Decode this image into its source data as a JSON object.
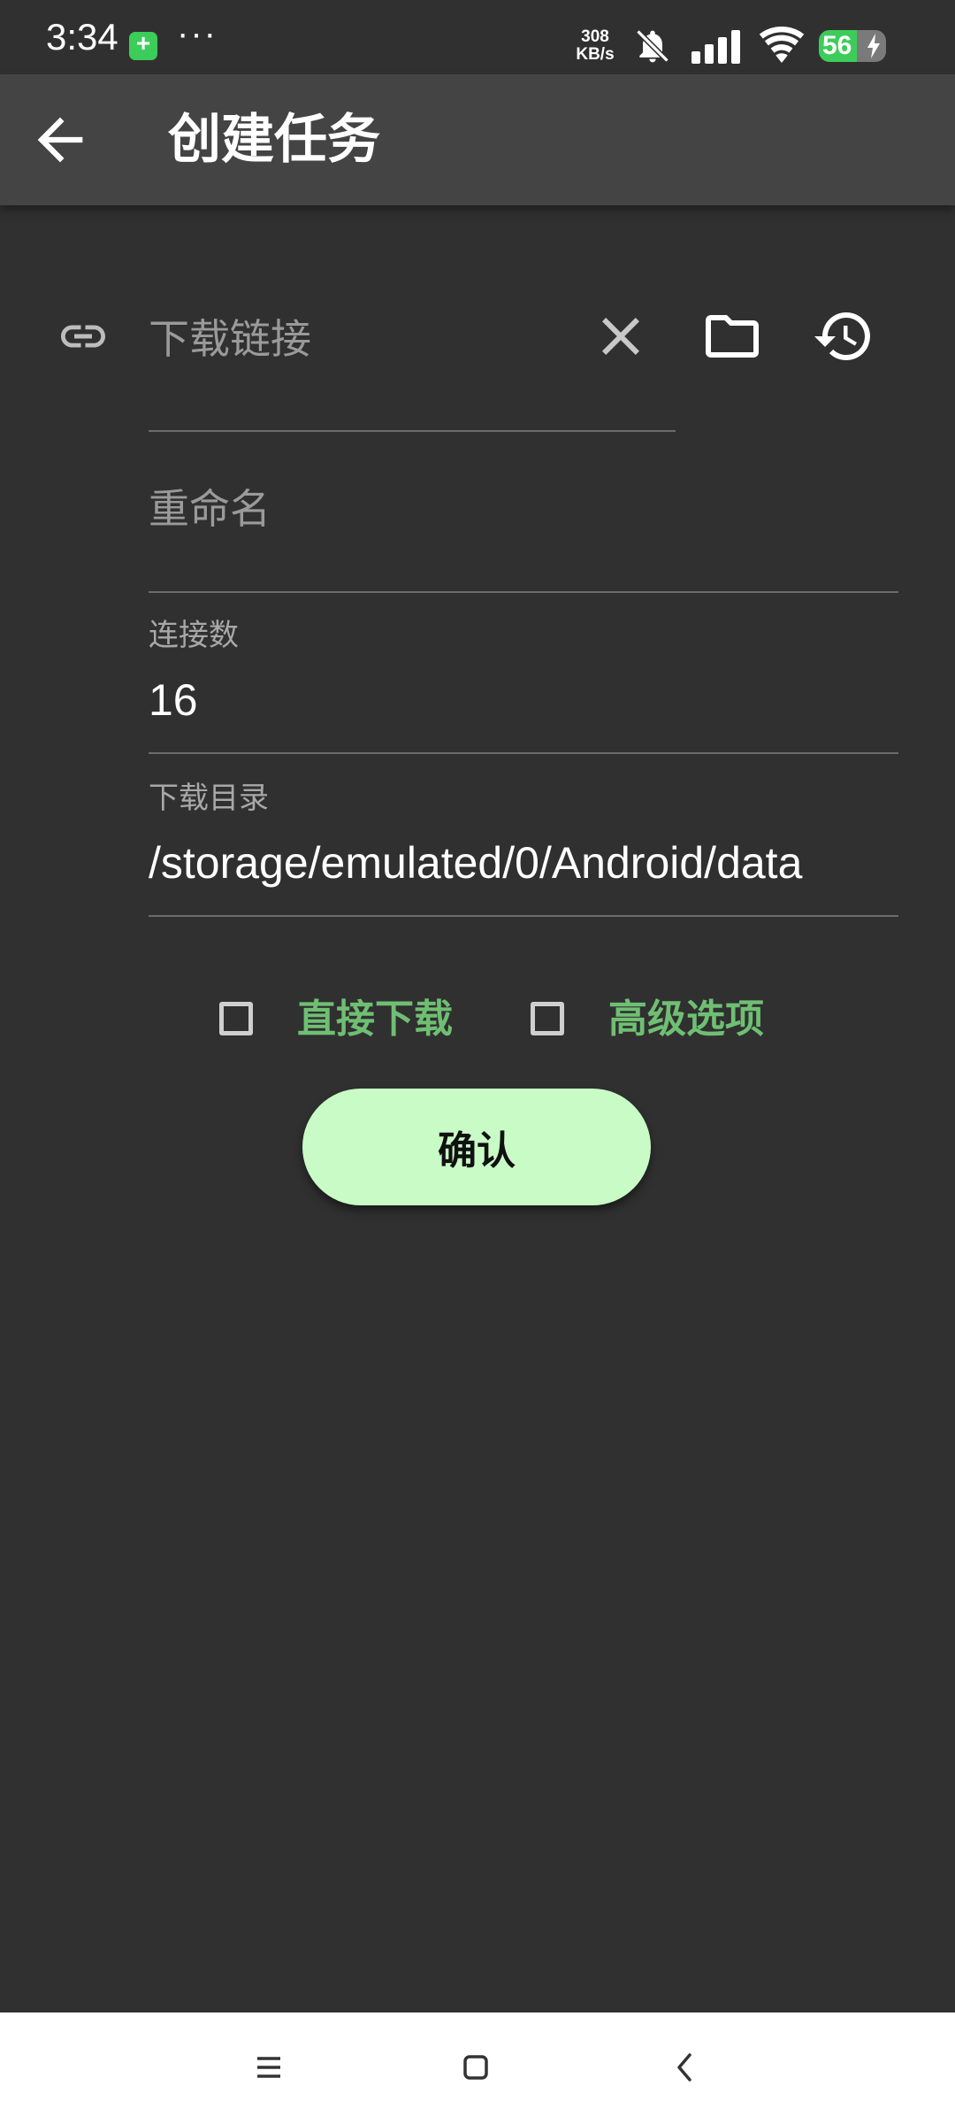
{
  "status_bar": {
    "time": "3:34",
    "overflow": "···",
    "net_speed_value": "308",
    "net_speed_unit": "KB/s",
    "battery_level": "56",
    "battery_fraction": 0.56,
    "icons": [
      "shield-icon",
      "bell-off-icon",
      "signal-icon",
      "wifi-icon",
      "battery-icon",
      "charging-icon"
    ]
  },
  "app_bar": {
    "title": "创建任务",
    "back_icon": "arrow-back-icon"
  },
  "form": {
    "url": {
      "placeholder": "下载链接",
      "value": "",
      "icons": [
        "link-icon",
        "clear-icon",
        "folder-icon",
        "history-icon"
      ]
    },
    "rename": {
      "placeholder": "重命名",
      "value": ""
    },
    "connections": {
      "label": "连接数",
      "value": "16"
    },
    "directory": {
      "label": "下载目录",
      "value": "/storage/emulated/0/Android/data"
    }
  },
  "options": {
    "direct_download": {
      "label": "直接下载",
      "checked": false
    },
    "advanced": {
      "label": "高级选项",
      "checked": false
    }
  },
  "confirm_label": "确认",
  "colors": {
    "background": "#303030",
    "app_bar": "#444444",
    "accent_green": "#6fbf73",
    "button_fill": "#c9fbc6",
    "nav_bar": "#ffffff"
  },
  "nav_bar": {
    "icons": [
      "menu-icon",
      "home-icon",
      "back-icon"
    ]
  }
}
